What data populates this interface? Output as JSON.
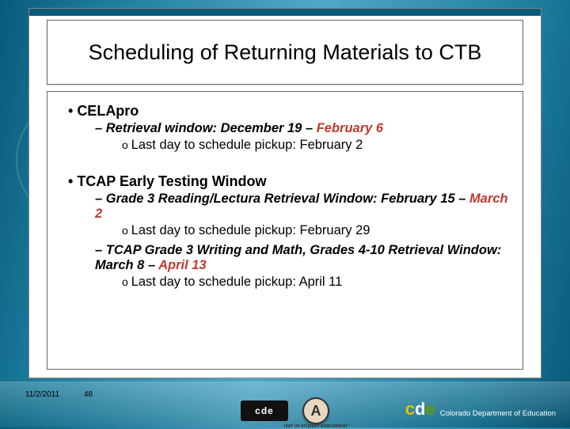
{
  "title": "Scheduling of Returning Materials to CTB",
  "sections": [
    {
      "heading": "CELApro",
      "items": [
        {
          "prefix": "Retrieval window: ",
          "range_start": "December 19",
          "range_sep": " – ",
          "range_end": "February 6",
          "sub": "Last day to schedule pickup: February 2"
        }
      ]
    },
    {
      "heading": "TCAP Early Testing Window",
      "items": [
        {
          "prefix": "Grade 3 Reading/Lectura Retrieval Window: ",
          "range_start": "February 15",
          "range_sep": " – ",
          "range_end": "March 2",
          "sub": "Last day to schedule pickup: February 29"
        },
        {
          "prefix": "TCAP Grade 3 Writing and Math, Grades 4-10 Retrieval Window: ",
          "range_start": "March 8",
          "range_sep": " – ",
          "range_end": "April 13",
          "sub": "Last day to schedule pickup: April 11"
        }
      ]
    }
  ],
  "footer": {
    "date": "11/2/2011",
    "page": "48",
    "logo_small": "cde",
    "logo_a": "A",
    "logo_a_sub": "UNIT OF STUDENT ASSESSMENT",
    "brand_tag": "Colorado Department of Education"
  }
}
